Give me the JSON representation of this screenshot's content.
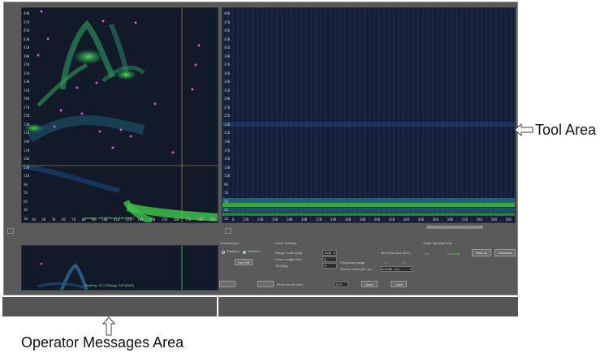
{
  "sonar_left_display": {
    "y_ticks": [
      "490",
      "470",
      "450",
      "430",
      "410",
      "390",
      "370",
      "350",
      "330",
      "310",
      "290",
      "270",
      "250",
      "230",
      "210",
      "190",
      "170",
      "150",
      "130",
      "110",
      "90",
      "70",
      "50",
      "30",
      "10"
    ],
    "x_ticks": [
      "30",
      "40",
      "50",
      "60",
      "70",
      "80",
      "90",
      "100",
      "110",
      "120",
      "130",
      "140",
      "150",
      "160",
      "170",
      "180",
      "190"
    ],
    "info_label": "Bearing: 107.3 Range: 345 (NNE)"
  },
  "sonar_right_display": {
    "y_ticks": [
      "490",
      "470",
      "450",
      "430",
      "410",
      "390",
      "370",
      "350",
      "330",
      "310",
      "290",
      "270",
      "250",
      "230",
      "210",
      "190",
      "170",
      "150",
      "130",
      "110",
      "90",
      "70",
      "50",
      "30",
      "10"
    ],
    "x_ticks": [
      "0",
      "220",
      "240",
      "260",
      "280",
      "300",
      "320",
      "340",
      "360",
      "380",
      "400",
      "420",
      "440",
      "460",
      "480",
      "500",
      "520",
      "540",
      "560",
      "580"
    ]
  },
  "mini_display": {
    "info_label": "Bearing: 107.3 Range: 345 (NNE)"
  },
  "transmission": {
    "title": "Transmission",
    "option_disabled": "Disabled",
    "option_enabled": "Enabled",
    "button": "Turn Off"
  },
  "sonar_settings": {
    "title": "Sonar Settings",
    "range_scale_label": "Range Scale (yds)",
    "range_scale_value": "1000",
    "pulse_length_label": "Pulse Length (ms)",
    "pulse_length_value": "5",
    "tilt_label": "Tilt (deg)",
    "tilt_value": "0",
    "frequency_label": "Frequency range",
    "min_max_label": "Min (kHz) Max (kHz)",
    "freq_min": "10",
    "freq_max": "20",
    "source_level_label": "Source Level (dB / 1µ",
    "source_level_value": "220dB - 1m"
  },
  "sonar_management": {
    "title": "Sonar Management",
    "status_off": "Off",
    "status_running": "Running",
    "button_startup": "Start up",
    "button_shutdown": "Shutdown"
  },
  "bottom_controls": {
    "ping_interval_label": "Ping Interval (sec)",
    "ping_interval_value": "10.0",
    "button_save": "Save",
    "button_load": "Load"
  },
  "annotations": {
    "tool_area": "Tool Area",
    "operator_messages_area": "Operator Messages Area"
  },
  "colors": {
    "app_background": "#5a5a5a",
    "display_background": "#121a2a",
    "sonar_green": "#3fd24a",
    "target_marker": "#d84fd8",
    "cursor_line": "#c8a040"
  }
}
